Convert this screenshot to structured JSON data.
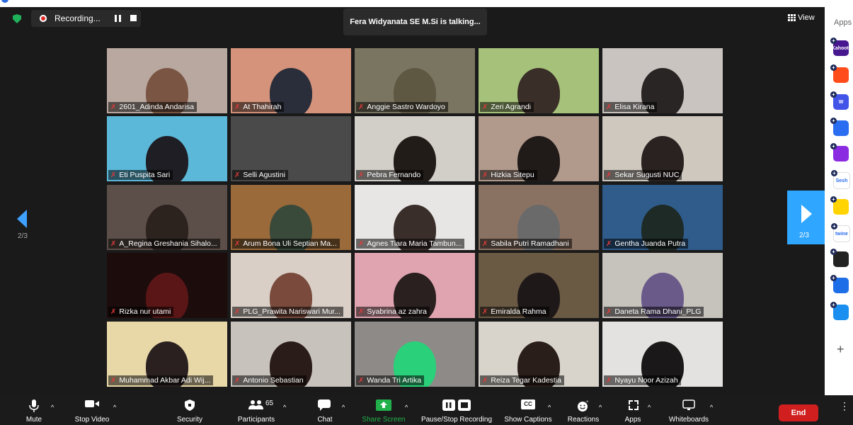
{
  "recording": {
    "label": "Recording..."
  },
  "speaker": {
    "text": "Fera Widyanata SE M.Si is talking..."
  },
  "view": {
    "label": "View"
  },
  "apps_panel": {
    "title": "Apps",
    "items": [
      {
        "icon": "kahoot-icon",
        "text": "Kahoot!",
        "color": "#46178f"
      },
      {
        "icon": "hopin-icon",
        "text": "",
        "color": "#ff4c1a"
      },
      {
        "icon": "wooclap-icon",
        "text": "W",
        "color": "#4254e8"
      },
      {
        "icon": "chat-bubble-app-icon",
        "text": "",
        "color": "#2a6df0"
      },
      {
        "icon": "purple-app-icon",
        "text": "",
        "color": "#8a2be2"
      },
      {
        "icon": "sesh-icon",
        "text": "Sesh",
        "color": "#ffffff"
      },
      {
        "icon": "smiley-app-icon",
        "text": "",
        "color": "#ffd400"
      },
      {
        "icon": "twine-icon",
        "text": "twine",
        "color": "#ffffff"
      },
      {
        "icon": "blocks-app-icon",
        "text": "",
        "color": "#222222"
      },
      {
        "icon": "sync-app-icon",
        "text": "",
        "color": "#1e6ee8"
      },
      {
        "icon": "e-app-icon",
        "text": "",
        "color": "#1a8ff0"
      }
    ]
  },
  "nav": {
    "left_page": "2/3",
    "right_page": "2/3"
  },
  "participants": [
    {
      "name": "2601_Adinda Andarisa",
      "bg": "#b9a8a0",
      "head": "#7a5544"
    },
    {
      "name": "At Thahirah",
      "bg": "#d4937a",
      "head": "#2a2d3a"
    },
    {
      "name": "Anggie Sastro Wardoyo",
      "bg": "#7a7560",
      "head": "#5e5843"
    },
    {
      "name": "Zeri Agrandi",
      "bg": "#a6c27a",
      "head": "#3a2e28"
    },
    {
      "name": "Elisa Kirana",
      "bg": "#c9c4bf",
      "head": "#2a2525"
    },
    {
      "name": "Eti Puspita Sari",
      "bg": "#5cb8d8",
      "head": "#1e1e24"
    },
    {
      "name": "Selli Agustini",
      "bg": "#4a4a4a",
      "head": ""
    },
    {
      "name": "Pebra Fernando",
      "bg": "#d2cfc8",
      "head": "#221c18"
    },
    {
      "name": "Hizkia Sitepu",
      "bg": "#b19a8c",
      "head": "#201a18"
    },
    {
      "name": "Sekar Sugusti NUC",
      "bg": "#cfc8bf",
      "head": "#2a2220"
    },
    {
      "name": "A_Regina Greshania Sihalo...",
      "bg": "#5c4e48",
      "head": "#2c221e"
    },
    {
      "name": "Arum Bona Uli Septian Ma...",
      "bg": "#9a6a3a",
      "head": "#3a4a3a"
    },
    {
      "name": "Agnes Tiara Maria Tambun...",
      "bg": "#e8e6e4",
      "head": "#3a2e2a"
    },
    {
      "name": "Sabila Putri Ramadhani",
      "bg": "#8a7262",
      "head": "#6a6a6a"
    },
    {
      "name": "Gentha Juanda Putra",
      "bg": "#2f5c8a",
      "head": "#1e2a26"
    },
    {
      "name": "Rizka nur utami",
      "bg": "#1c0c0c",
      "head": "#5a1616"
    },
    {
      "name": "PLG_Prawita Nariswari Mur...",
      "bg": "#d9cfc6",
      "head": "#7a4a3c"
    },
    {
      "name": "Syabrina az zahra",
      "bg": "#e0a4b0",
      "head": "#2a2020"
    },
    {
      "name": "Emiralda Rahma",
      "bg": "#6a5a44",
      "head": "#1e1818"
    },
    {
      "name": "Daneta Rama Dhani_PLG",
      "bg": "#c6c2bc",
      "head": "#6a5a8a"
    },
    {
      "name": "Muhammad Akbar Adi Wij...",
      "bg": "#e8d8a8",
      "head": "#2a2020"
    },
    {
      "name": "Antonio Sebastian",
      "bg": "#c8c2bc",
      "head": "#2a1c18"
    },
    {
      "name": "Wanda Tri Artika",
      "bg": "#8e8a88",
      "head": "#2ad07a"
    },
    {
      "name": "Reiza Tegar Kadestia",
      "bg": "#d8d4cc",
      "head": "#2a1e1a"
    },
    {
      "name": "Nyayu Noor Azizah",
      "bg": "#e4e2e0",
      "head": "#1a1818"
    }
  ],
  "toolbar": {
    "mute": "Mute",
    "stop_video": "Stop Video",
    "security": "Security",
    "participants": "Participants",
    "participants_count": "65",
    "chat": "Chat",
    "share_screen": "Share Screen",
    "pause_stop_recording": "Pause/Stop Recording",
    "show_captions": "Show Captions",
    "reactions": "Reactions",
    "apps": "Apps",
    "whiteboards": "Whiteboards",
    "end": "End",
    "cc_text": "CC"
  },
  "colors": {
    "accent": "#2fa6ff",
    "share_green": "#21b14b",
    "end_red": "#d11f1f"
  }
}
